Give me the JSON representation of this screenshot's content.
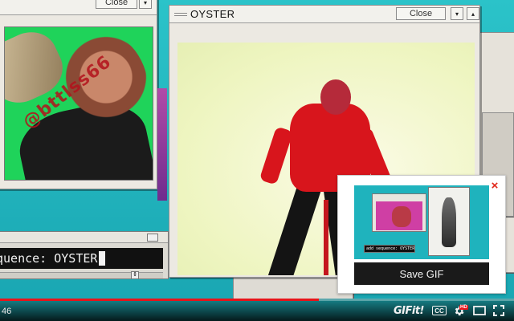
{
  "left_window": {
    "close_label": "Close",
    "arrow": "▾",
    "watermark": "@bttlss66"
  },
  "main_window": {
    "title": "OYSTER",
    "close_label": "Close",
    "arrow_down": "▾",
    "arrow_up": "▴"
  },
  "command_bar": {
    "text": "quence: OYSTER",
    "scroll_arrow": "⇕"
  },
  "gif_popup": {
    "close": "×",
    "preview_command": "add sequence: OYSTER",
    "save_label": "Save GIF"
  },
  "player": {
    "time": "46",
    "progress_fraction": 0.62,
    "gif_logo": "GIFit!",
    "cc_label": "CC",
    "settings_icon": "gear-icon",
    "hd_badge": "HD",
    "theater_icon": "theater-icon",
    "fullscreen_icon": "fullscreen-icon"
  },
  "colors": {
    "background": "#1fb3bd",
    "progress": "#e8141a",
    "popup_close": "#e1271a",
    "save_button": "#1a1a1a"
  }
}
